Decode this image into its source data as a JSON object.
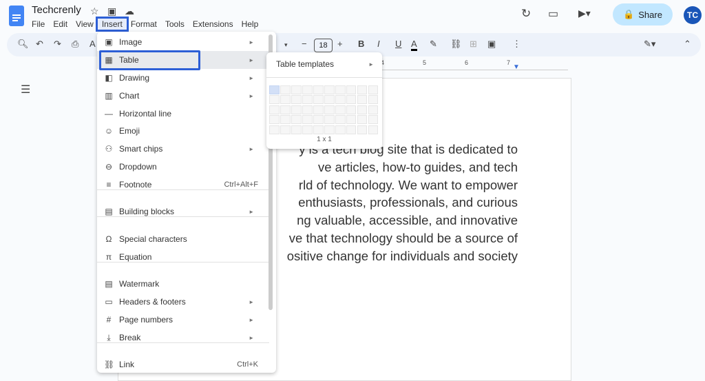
{
  "doc_title": "Techcrenly",
  "menubar": [
    "File",
    "Edit",
    "View",
    "Insert",
    "Format",
    "Tools",
    "Extensions",
    "Help"
  ],
  "active_menu": "Insert",
  "share_label": "Share",
  "avatar_initials": "TC",
  "toolbar": {
    "font_size": "18"
  },
  "ruler_ticks": [
    "4",
    "5",
    "6",
    "7"
  ],
  "insert_menu": [
    {
      "label": "Image",
      "icon": "image-icon",
      "submenu": true
    },
    {
      "label": "Table",
      "icon": "table-icon",
      "submenu": true,
      "highlighted": true
    },
    {
      "label": "Drawing",
      "icon": "drawing-icon",
      "submenu": true
    },
    {
      "label": "Chart",
      "icon": "chart-icon",
      "submenu": true
    },
    {
      "label": "Horizontal line",
      "icon": "horizontal-line-icon"
    },
    {
      "label": "Emoji",
      "icon": "emoji-icon"
    },
    {
      "label": "Smart chips",
      "icon": "smart-chips-icon",
      "submenu": true
    },
    {
      "label": "Dropdown",
      "icon": "dropdown-icon"
    },
    {
      "label": "Footnote",
      "icon": "footnote-icon",
      "shortcut": "Ctrl+Alt+F"
    },
    {
      "label": "Building blocks",
      "icon": "building-blocks-icon",
      "submenu": true
    },
    {
      "label": "Special characters",
      "icon": "omega-icon"
    },
    {
      "label": "Equation",
      "icon": "pi-icon"
    },
    {
      "label": "Watermark",
      "icon": "watermark-icon"
    },
    {
      "label": "Headers & footers",
      "icon": "headers-footers-icon",
      "submenu": true
    },
    {
      "label": "Page numbers",
      "icon": "hash-icon",
      "submenu": true
    },
    {
      "label": "Break",
      "icon": "break-icon",
      "submenu": true
    },
    {
      "label": "Link",
      "icon": "link-icon",
      "shortcut": "Ctrl+K"
    }
  ],
  "table_submenu": {
    "templates_label": "Table templates",
    "grid_size_label": "1 x 1",
    "grid_columns": 10,
    "grid_rows": 5,
    "selected": "1 x 1"
  },
  "document_lines": [
    "y is a tech blog site that is dedicated to",
    "ve articles, how-to guides, and tech",
    "rld of technology. We want to empower",
    "enthusiasts, professionals, and curious",
    "ng valuable, accessible, and innovative",
    "ve that technology should be a source of",
    "ositive change for individuals and society"
  ],
  "colors": {
    "accent": "#2d5fd6",
    "share_bg": "#c2e7ff",
    "toolbar_bg": "#edf2fa"
  }
}
